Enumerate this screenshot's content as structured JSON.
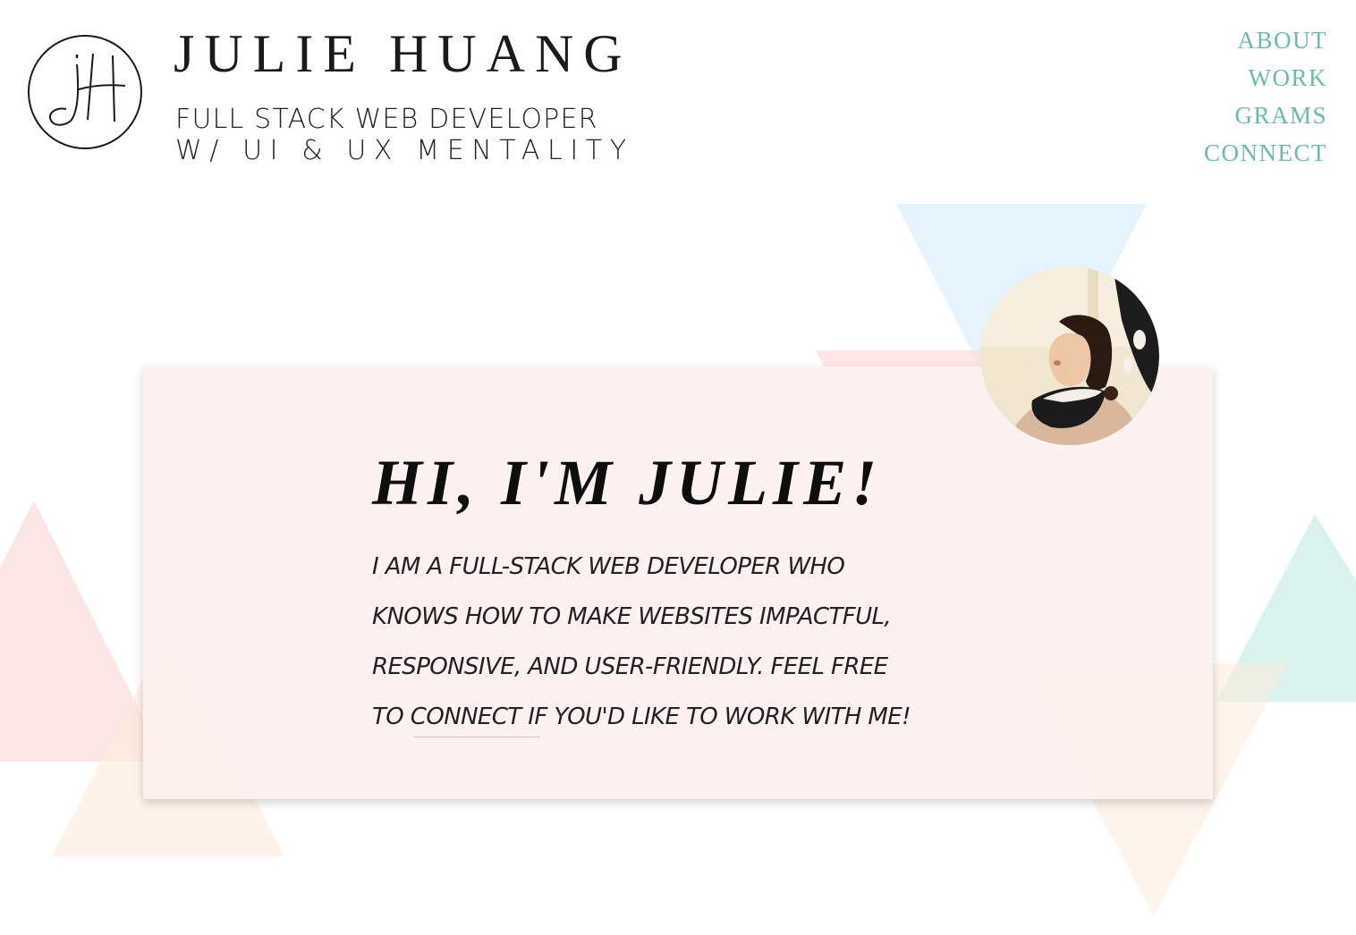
{
  "header": {
    "logo_icon": "jh-monogram-icon",
    "name": "JULIE HUANG",
    "tagline_line1": "FULL STACK WEB DEVELOPER",
    "tagline_line2": "W/ UI & UX MENTALITY"
  },
  "nav": {
    "items": [
      {
        "label": "ABOUT"
      },
      {
        "label": "WORK"
      },
      {
        "label": "GRAMS"
      },
      {
        "label": "CONNECT"
      }
    ]
  },
  "hero": {
    "heading": "HI, I'M JULIE!",
    "lines": [
      "I AM A FULL-STACK WEB DEVELOPER WHO",
      "KNOWS HOW TO MAKE WEBSITES IMPACTFUL,",
      "RESPONSIVE, AND USER-FRIENDLY. FEEL FREE",
      "TO CONNECT IF YOU'D LIKE TO WORK WITH ME!"
    ]
  },
  "colors": {
    "accent": "#6fb8ad",
    "card_bg": "#fdf0f0",
    "tri_blue": "#dff1fb",
    "tri_pink": "#fbdcdc",
    "tri_teal": "#c9ede6",
    "tri_peach": "#fcebdc"
  }
}
